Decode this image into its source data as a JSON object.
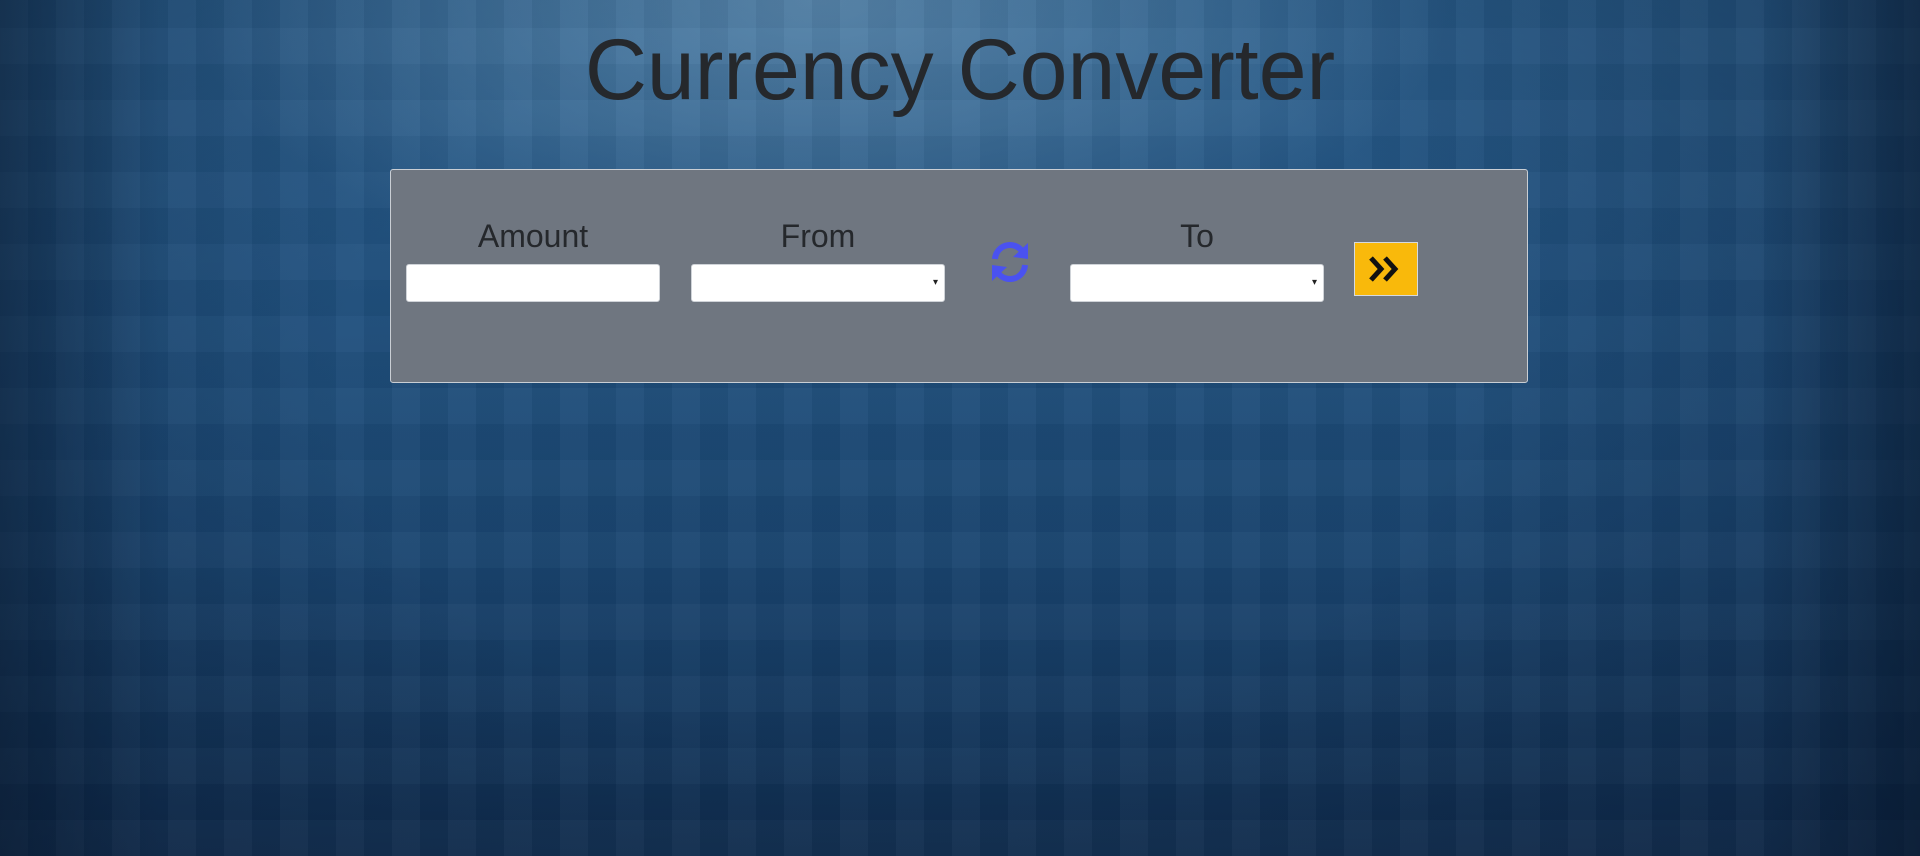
{
  "page": {
    "title": "Currency Converter"
  },
  "form": {
    "amount": {
      "label": "Amount",
      "value": "",
      "placeholder": ""
    },
    "from": {
      "label": "From",
      "selected": ""
    },
    "to": {
      "label": "To",
      "selected": ""
    },
    "swap_icon": "swap-arrows-icon",
    "convert_icon": "double-chevron-right-icon"
  },
  "colors": {
    "panel_background": "#6f7680",
    "convert_button": "#f9b90b",
    "swap_icon": "#4a52f0",
    "title_text": "#25282c"
  }
}
